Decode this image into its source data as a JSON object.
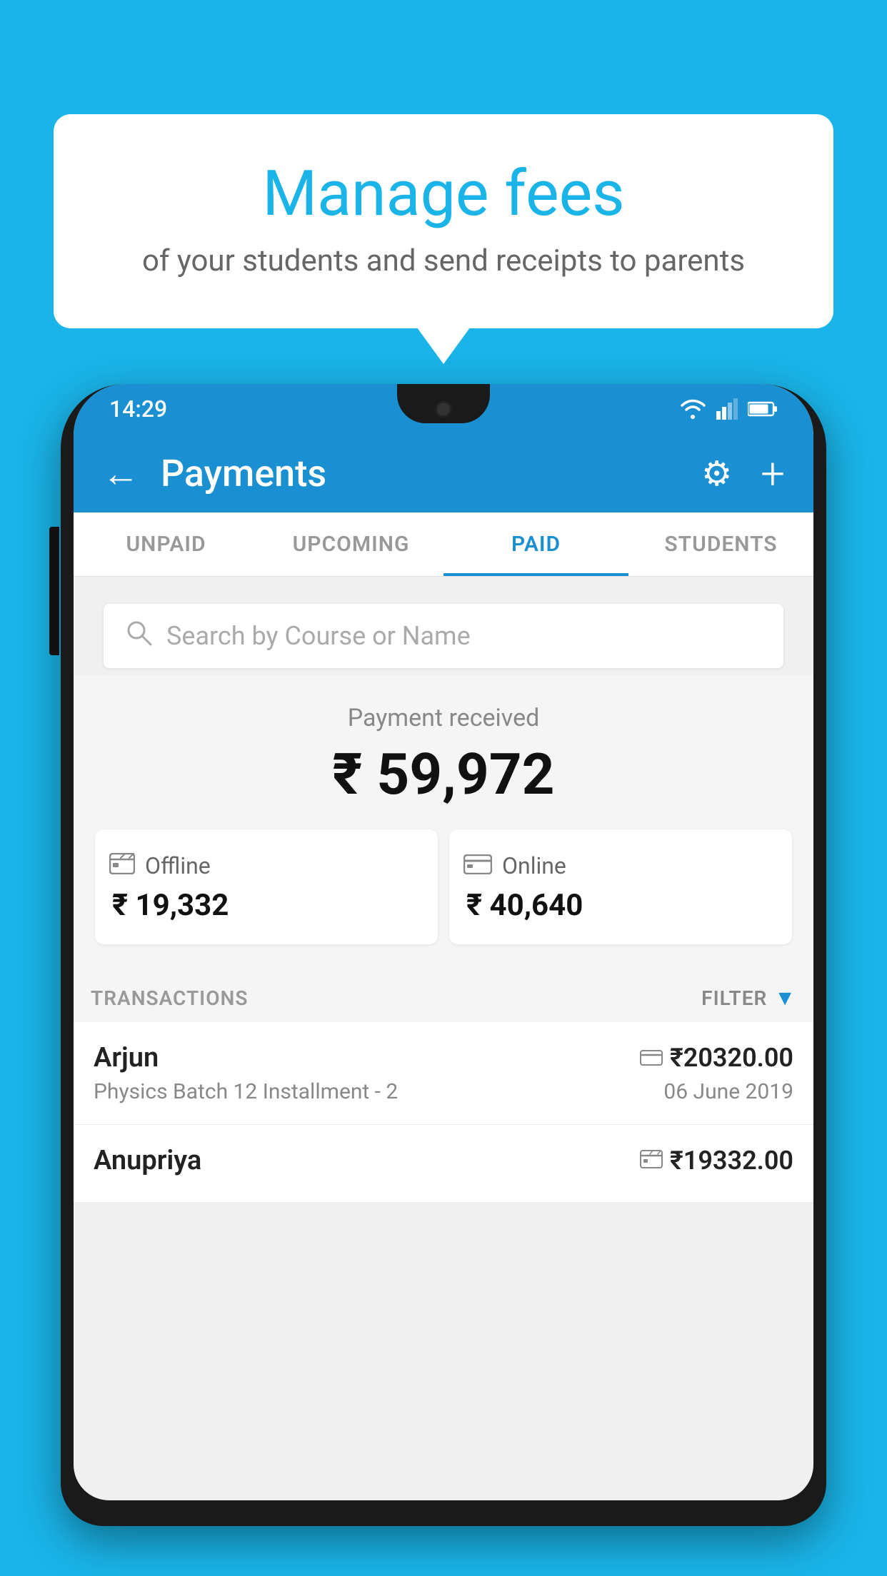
{
  "background_color": "#1ab4e8",
  "bubble": {
    "title": "Manage fees",
    "subtitle": "of your students and send receipts to parents"
  },
  "status_bar": {
    "time": "14:29",
    "bg_color": "#1a8fd1"
  },
  "app_bar": {
    "title": "Payments",
    "back_label": "←",
    "settings_label": "⚙",
    "add_label": "+"
  },
  "tabs": [
    {
      "label": "UNPAID",
      "active": false
    },
    {
      "label": "UPCOMING",
      "active": false
    },
    {
      "label": "PAID",
      "active": true
    },
    {
      "label": "STUDENTS",
      "active": false
    }
  ],
  "search": {
    "placeholder": "Search by Course or Name"
  },
  "payment_summary": {
    "label": "Payment received",
    "amount": "₹ 59,972",
    "offline": {
      "label": "Offline",
      "amount": "₹ 19,332"
    },
    "online": {
      "label": "Online",
      "amount": "₹ 40,640"
    }
  },
  "transactions": {
    "header_label": "TRANSACTIONS",
    "filter_label": "FILTER",
    "items": [
      {
        "name": "Arjun",
        "course": "Physics Batch 12 Installment - 2",
        "amount": "₹20320.00",
        "date": "06 June 2019",
        "payment_type": "card"
      },
      {
        "name": "Anupriya",
        "course": "",
        "amount": "₹19332.00",
        "date": "",
        "payment_type": "offline"
      }
    ]
  }
}
